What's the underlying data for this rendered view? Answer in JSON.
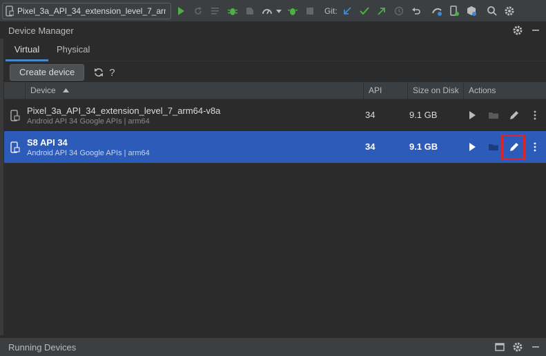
{
  "toolbar": {
    "config_label": "Pixel_3a_API_34_extension_level_7_arm..",
    "git_label": "Git:"
  },
  "device_manager": {
    "title": "Device Manager",
    "tabs": [
      {
        "label": "Virtual",
        "active": true
      },
      {
        "label": "Physical",
        "active": false
      }
    ],
    "create_label": "Create device",
    "help_label": "?"
  },
  "table": {
    "columns": [
      "Device",
      "API",
      "Size on Disk",
      "Actions"
    ],
    "rows": [
      {
        "name": "Pixel_3a_API_34_extension_level_7_arm64-v8a",
        "sub": "Android API 34 Google APIs | arm64",
        "api": "34",
        "size": "9.1 GB",
        "selected": false
      },
      {
        "name": "S8  API 34",
        "sub": "Android API 34 Google APIs | arm64",
        "api": "34",
        "size": "9.1 GB",
        "selected": true
      }
    ]
  },
  "running_devices": {
    "title": "Running Devices"
  },
  "colors": {
    "accent": "#2d5bba",
    "highlight": "#d8262c",
    "run_green": "#4fae47"
  }
}
